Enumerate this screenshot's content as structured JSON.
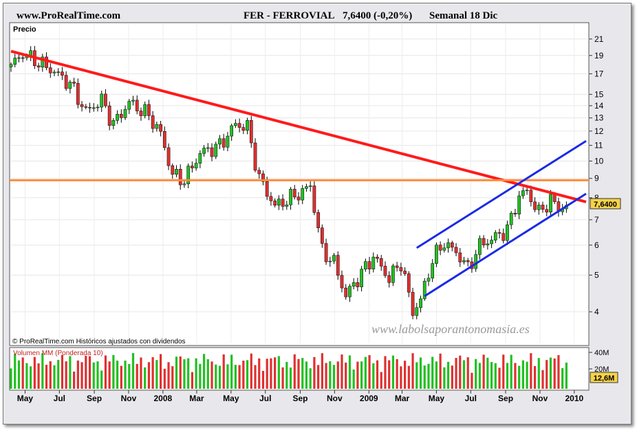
{
  "header": {
    "site": "www.ProRealTime.com",
    "ticker": "FER - FERROVIAL",
    "change": "7,6400 (-0,20%)",
    "period": "Semanal  18 Dic"
  },
  "price_panel": {
    "label": "Precio",
    "last_price_tag": "7,6400",
    "copyright": "© ProRealTime.com  Históricos ajustados con dividendos",
    "watermark": "www.labolsaporantonomasia.es"
  },
  "volume_panel": {
    "label": "Volumen MM (Ponderada 10)",
    "last_volume_tag": "12,6M"
  },
  "colors": {
    "up": "#22c022",
    "down": "#e03030",
    "trendline": "#ff1a1a",
    "resistance": "#ff8c3a",
    "channel": "#1a2ae6",
    "tag": "#f5d24a",
    "background": "#e8e8ec",
    "panel": "#ffffff"
  },
  "chart_data": {
    "type": "candlestick",
    "title": "FER - FERROVIAL 7,6400 (-0,20%) Semanal 18 Dic",
    "y_scale": "log",
    "y_ticks": [
      4,
      5,
      6,
      7,
      8,
      9,
      10,
      11,
      12,
      13,
      14,
      15,
      17,
      19,
      21
    ],
    "ylim": [
      3.3,
      23
    ],
    "x_ticks": [
      "May",
      "Jul",
      "Sep",
      "Nov",
      "2008",
      "Mar",
      "May",
      "Jul",
      "Sep",
      "Nov",
      "2009",
      "Mar",
      "May",
      "Jul",
      "Sep",
      "Nov",
      "2010"
    ],
    "x_tick_dates": [
      "2007-05",
      "2007-07",
      "2007-09",
      "2007-11",
      "2008-01",
      "2008-03",
      "2008-05",
      "2008-07",
      "2008-09",
      "2008-11",
      "2009-01",
      "2009-03",
      "2009-05",
      "2009-07",
      "2009-09",
      "2009-11",
      "2010-01"
    ],
    "x_range": [
      "2007-04-06",
      "2010-01-22"
    ],
    "close_waypoints": [
      {
        "date": "2007-04-06",
        "close": 18.0
      },
      {
        "date": "2007-04-27",
        "close": 19.2
      },
      {
        "date": "2007-06-15",
        "close": 17.5
      },
      {
        "date": "2007-07-20",
        "close": 16.0
      },
      {
        "date": "2007-08-17",
        "close": 13.5
      },
      {
        "date": "2007-09-14",
        "close": 14.5
      },
      {
        "date": "2007-10-05",
        "close": 12.5
      },
      {
        "date": "2007-11-02",
        "close": 14.3
      },
      {
        "date": "2007-12-07",
        "close": 13.2
      },
      {
        "date": "2007-12-28",
        "close": 11.8
      },
      {
        "date": "2008-01-18",
        "close": 9.2
      },
      {
        "date": "2008-02-08",
        "close": 8.9
      },
      {
        "date": "2008-03-07",
        "close": 10.5
      },
      {
        "date": "2008-04-11",
        "close": 11.0
      },
      {
        "date": "2008-05-09",
        "close": 12.5
      },
      {
        "date": "2008-05-30",
        "close": 12.3
      },
      {
        "date": "2008-06-20",
        "close": 9.0
      },
      {
        "date": "2008-07-18",
        "close": 7.6
      },
      {
        "date": "2008-08-15",
        "close": 8.0
      },
      {
        "date": "2008-09-05",
        "close": 8.3
      },
      {
        "date": "2008-09-19",
        "close": 8.6
      },
      {
        "date": "2008-10-10",
        "close": 5.8
      },
      {
        "date": "2008-10-31",
        "close": 5.4
      },
      {
        "date": "2008-11-21",
        "close": 4.4
      },
      {
        "date": "2008-12-12",
        "close": 4.9
      },
      {
        "date": "2009-01-09",
        "close": 5.6
      },
      {
        "date": "2009-02-06",
        "close": 4.9
      },
      {
        "date": "2009-02-27",
        "close": 5.4
      },
      {
        "date": "2009-03-20",
        "close": 4.0
      },
      {
        "date": "2009-04-03",
        "close": 4.3
      },
      {
        "date": "2009-04-24",
        "close": 5.5
      },
      {
        "date": "2009-05-15",
        "close": 6.1
      },
      {
        "date": "2009-06-12",
        "close": 5.6
      },
      {
        "date": "2009-06-26",
        "close": 5.2
      },
      {
        "date": "2009-07-17",
        "close": 6.0
      },
      {
        "date": "2009-08-14",
        "close": 6.3
      },
      {
        "date": "2009-09-04",
        "close": 6.6
      },
      {
        "date": "2009-09-25",
        "close": 8.1
      },
      {
        "date": "2009-10-09",
        "close": 8.3
      },
      {
        "date": "2009-10-30",
        "close": 7.3
      },
      {
        "date": "2009-11-20",
        "close": 7.9
      },
      {
        "date": "2009-12-04",
        "close": 7.5
      },
      {
        "date": "2009-12-18",
        "close": 7.64
      }
    ],
    "volume_ticks": [
      "40M",
      "20M"
    ],
    "annotations": [
      {
        "kind": "descending-trendline",
        "from": {
          "date": "2007-04-06",
          "price": 19.5
        },
        "to": {
          "date": "2010-01-22",
          "price": 7.8
        }
      },
      {
        "kind": "horizontal-resistance",
        "price": 8.9
      },
      {
        "kind": "channel-upper",
        "from": {
          "date": "2009-03-27",
          "price": 5.9
        },
        "to": {
          "date": "2010-01-22",
          "price": 11.3
        }
      },
      {
        "kind": "channel-lower",
        "from": {
          "date": "2009-04-10",
          "price": 4.4
        },
        "to": {
          "date": "2010-01-22",
          "price": 8.2
        }
      }
    ]
  }
}
